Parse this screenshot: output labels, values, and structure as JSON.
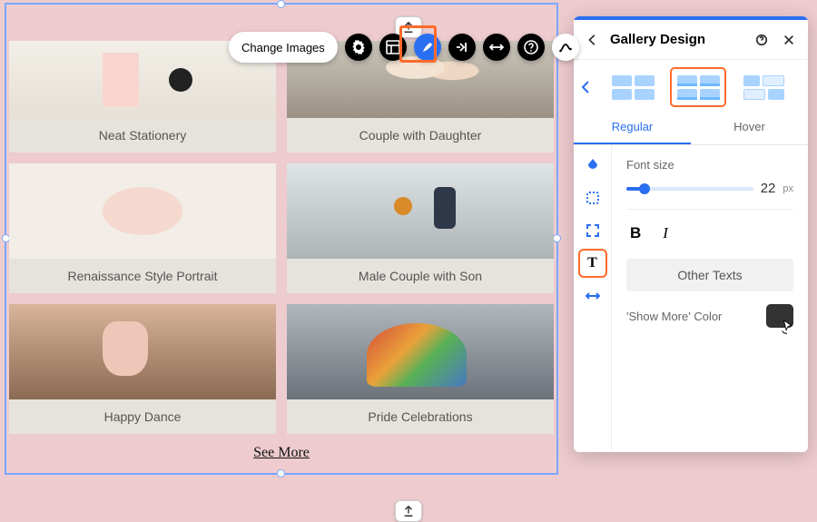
{
  "toolbar": {
    "change_images": "Change Images"
  },
  "gallery": {
    "captions": [
      "Neat Stationery",
      "Couple with Daughter",
      "Renaissance Style Portrait",
      "Male Couple with Son",
      "Happy Dance",
      "Pride Celebrations"
    ],
    "see_more": "See More"
  },
  "panel": {
    "title": "Gallery Design",
    "tabs": {
      "regular": "Regular",
      "hover": "Hover"
    },
    "font_size_label": "Font size",
    "font_size_value": "22",
    "font_size_unit": "px",
    "other_texts": "Other Texts",
    "show_more_color": "'Show More' Color",
    "swatch_color": "#333333"
  }
}
